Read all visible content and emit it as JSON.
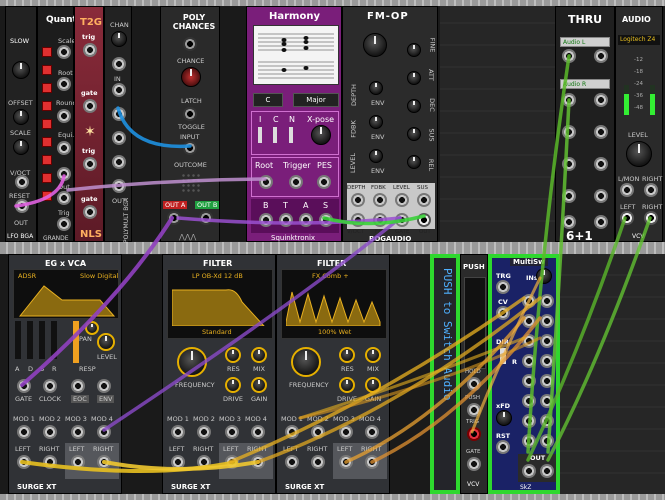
{
  "modules": {
    "lfo": {
      "title": "LFO BGA",
      "slow": "SLOW",
      "offset": "OFFSET",
      "scale": "SCALE",
      "vout": "V/OCT",
      "reset": "RESET",
      "out": "OUT"
    },
    "quant": {
      "title": "Quant",
      "scale": "Scale",
      "root": "Root",
      "round": "Round",
      "equi": "Equi.",
      "out": "Out",
      "trig": "Trig",
      "footer": "GRANDE"
    },
    "t2g": {
      "title": "T2G",
      "trig1": "trig",
      "gate1": "gate",
      "trig2": "trig",
      "gate2": "gate",
      "footer": "NLS"
    },
    "polymult": {
      "title": "POLYMULT BGA",
      "chan": "CHAN",
      "in": "IN",
      "out": "OUT"
    },
    "poly_chances": {
      "title": "POLY CHANCES",
      "chance": "CHANCE",
      "latch": "LATCH",
      "toggle": "TOGGLE",
      "input": "INPUT",
      "outcome": "OUTCOME",
      "out_a": "OUT A",
      "out_b": "OUT B"
    },
    "harmony": {
      "title": "Harmony",
      "key": "C",
      "mode": "Major",
      "i_label": "I",
      "c_label": "C",
      "n_label": "N",
      "xpose": "X-pose",
      "root": "Root",
      "trigger": "Trigger",
      "pes": "PES",
      "b": "B",
      "t": "T",
      "a": "A",
      "s": "S",
      "footer": "Squinktronix"
    },
    "fm_op": {
      "title": "FM-OP",
      "fine": "FINE",
      "att": "ATT",
      "dec": "DEC",
      "sus": "SUS",
      "rel": "REL",
      "depth": "DEPTH",
      "fdbk": "FDBK",
      "level": "LEVEL",
      "env": "ENV",
      "jack_labels": [
        "DEPTH",
        "FDBK",
        "LEVEL",
        "SUS",
        "V/OCT",
        "FM",
        "GATE",
        "OUT"
      ],
      "footer": "BOGAUDIO"
    },
    "thru": {
      "title": "THRU",
      "ch1": "Audio L",
      "ch2": "Audio R",
      "footer": "6+1"
    },
    "audio": {
      "title": "AUDIO",
      "device": "Logitech Z4",
      "db_labels": [
        "-12",
        "-18",
        "-24",
        "-36",
        "-48"
      ],
      "level": "LEVEL",
      "lmon": "L/MON",
      "right": "RIGHT",
      "left": "LEFT",
      "footer": "VCV"
    },
    "eg_vca": {
      "title": "EG x VCA",
      "adsr": "ADSR",
      "mode": "Slow Digital",
      "pan": "PAN",
      "level": "LEVEL",
      "resp": "RESP",
      "a": "A",
      "d": "D",
      "s": "S",
      "r": "R",
      "gate": "GATE",
      "clock": "CLOCK",
      "eoc": "EOC",
      "env": "ENV",
      "mods": [
        "MOD 1",
        "MOD 2",
        "MOD 3",
        "MOD 4"
      ],
      "left": "LEFT",
      "right": "RIGHT",
      "brand": "SURGE XT"
    },
    "filter1": {
      "title": "FILTER",
      "type": "LP OB-Xd 12 dB",
      "sub": "Standard",
      "frequency": "FREQUENCY",
      "res": "RES",
      "mix": "MIX",
      "drive": "DRIVE",
      "gain": "GAIN",
      "mods": [
        "MOD 1",
        "MOD 2",
        "MOD 3",
        "MOD 4"
      ],
      "left": "LEFT",
      "right": "RIGHT",
      "brand": "SURGE XT"
    },
    "filter2": {
      "title": "FILTER",
      "type": "FX Comb +",
      "sub": "100% Wet",
      "frequency": "FREQUENCY",
      "res": "RES",
      "mix": "MIX",
      "drive": "DRIVE",
      "gain": "GAIN",
      "mods": [
        "MOD 1",
        "MOD 2",
        "MOD 3",
        "MOD 4"
      ],
      "left": "LEFT",
      "right": "RIGHT",
      "brand": "SURGE XT"
    },
    "push": {
      "title": "PUSH",
      "vertical": "PUSH to Switch Audio",
      "hold": "HOLD",
      "push": "PUSH",
      "trig": "TRIG",
      "gate": "GATE",
      "footer": "VCV"
    },
    "multisw": {
      "title": "MultiSw",
      "trg": "TRG",
      "cv": "CV",
      "dir": "DIR",
      "r": "R",
      "ins": "INs",
      "xfd": "xFD",
      "rst": "RST",
      "out": "OUT",
      "footer": "SkZ"
    }
  }
}
